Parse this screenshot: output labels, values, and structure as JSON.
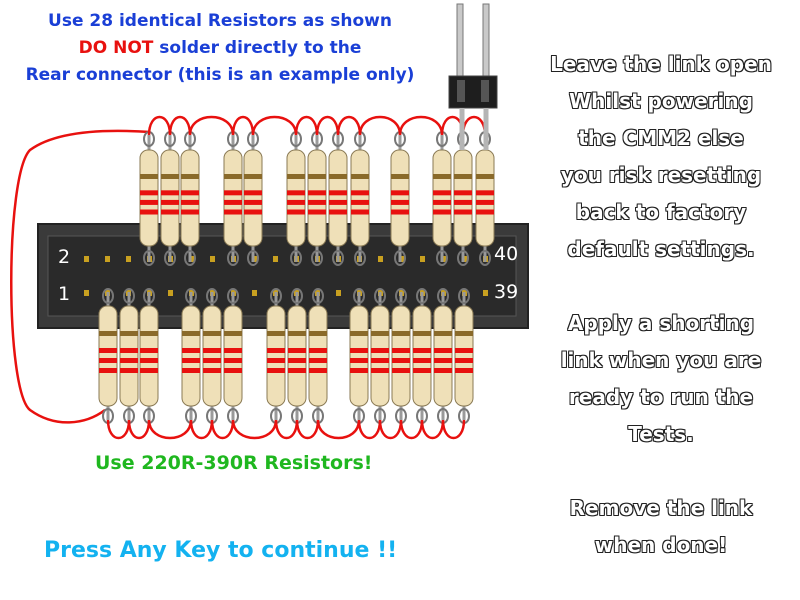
{
  "header": {
    "line1": "Use 28 identical Resistors as shown",
    "line2_emphasis": "DO NOT",
    "line2_rest": " solder directly to the",
    "line3": "Rear connector (this is an example only)"
  },
  "connector": {
    "pin_top_left": "2",
    "pin_bottom_left": "1",
    "pin_top_right": "40",
    "pin_bottom_right": "39"
  },
  "resistor_note": "Use 220R-390R Resistors!",
  "side_note": [
    "Leave the link open",
    "Whilst powering",
    "the CMM2 else",
    "you risk resetting",
    "back to factory",
    "default settings.",
    "",
    "Apply a shorting",
    "link when you are",
    "ready to run the",
    "Tests.",
    "",
    "Remove the link",
    "when done!"
  ],
  "footer": {
    "prompt": "Press Any Key to continue !!"
  },
  "colors": {
    "header_blue": "#1a3fd6",
    "warning_red": "#e8110f",
    "note_green": "#1fb71f",
    "prompt_cyan": "#13b2f0",
    "wire_red": "#e8110f",
    "connector_body": "#333333"
  }
}
